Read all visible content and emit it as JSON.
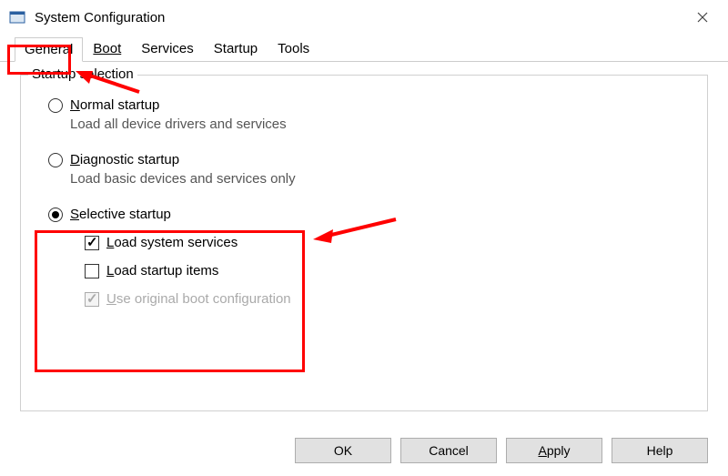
{
  "window": {
    "title": "System Configuration"
  },
  "tabs": {
    "general": "General",
    "boot": "Boot",
    "services": "Services",
    "startup": "Startup",
    "tools": "Tools",
    "active": "general"
  },
  "groupbox": {
    "legend": "Startup selection"
  },
  "radios": {
    "normal": {
      "label_pre": "N",
      "label_post": "ormal startup",
      "desc": "Load all device drivers and services",
      "checked": false
    },
    "diagnostic": {
      "label_pre": "D",
      "label_post": "iagnostic startup",
      "desc": "Load basic devices and services only",
      "checked": false
    },
    "selective": {
      "label_pre": "S",
      "label_post": "elective startup",
      "checked": true
    }
  },
  "checkboxes": {
    "load_system": {
      "label_pre": "L",
      "label_post": "oad system services",
      "checked": true
    },
    "load_startup": {
      "label_pre": "L",
      "label_post": "oad startup items",
      "checked": false
    },
    "use_original": {
      "label_pre": "U",
      "label_post": "se original boot configuration",
      "checked": true,
      "disabled": true
    }
  },
  "buttons": {
    "ok": "OK",
    "cancel": "Cancel",
    "apply_pre": "A",
    "apply_post": "pply",
    "help": "Help"
  }
}
